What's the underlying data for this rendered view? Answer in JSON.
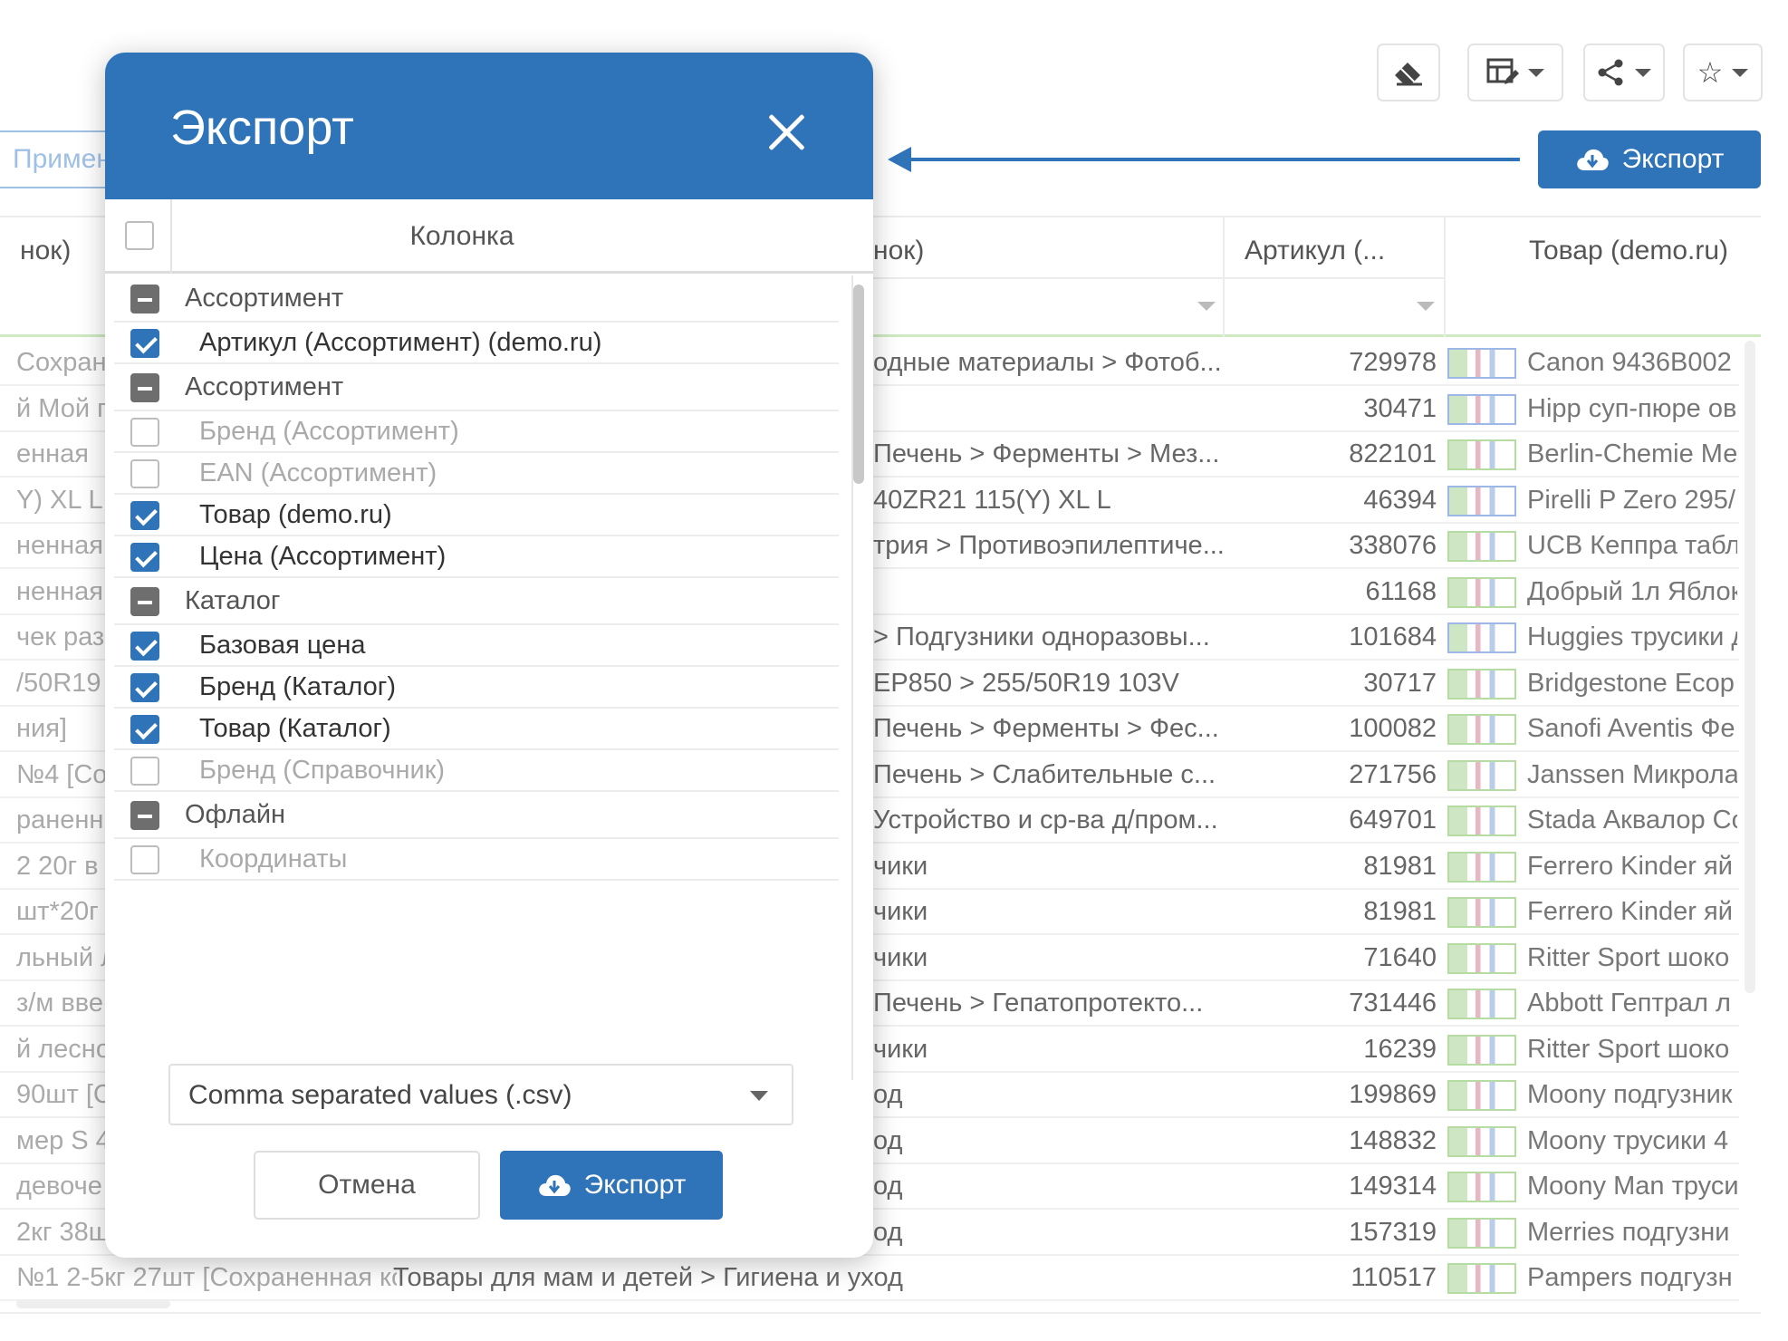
{
  "toolbar": {
    "clear_icon": "eraser-icon",
    "table_edit_icon": "table-edit-icon",
    "share_icon": "share-icon",
    "favorite_icon": "star-icon",
    "export_label": "Экспорт",
    "apply_label": "Применить"
  },
  "table": {
    "headers": {
      "category_partial": "нок)",
      "left_partial": "нок)",
      "article": "Артикул (...",
      "product": "Товар (demo.ru)"
    },
    "rows": [
      {
        "left": "Сохран",
        "category": "одные материалы > Фотоб...",
        "article": "729978",
        "name": "Canon 9436B002"
      },
      {
        "left": "й Мой г",
        "category": "",
        "article": "30471",
        "name": "Hipp суп-пюре ов"
      },
      {
        "left": "енная",
        "category": "Печень > Ферменты > Мез...",
        "article": "822101",
        "name": "Berlin-Chemie Ме"
      },
      {
        "left": "Y) XL L [",
        "category": "40ZR21 115(Y) XL L",
        "article": "46394",
        "name": "Pirelli P Zero 295/"
      },
      {
        "left": "ненная",
        "category": "трия > Противоэпилептиче...",
        "article": "338076",
        "name": "UCB Кеппра табл"
      },
      {
        "left": "ненная",
        "category": "",
        "article": "61168",
        "name": "Добрый 1л Яблок"
      },
      {
        "left": "чек раз",
        "category": "> Подгузники одноразовы...",
        "article": "101684",
        "name": "Huggies трусики д"
      },
      {
        "left": "/50R19",
        "category": "EP850 > 255/50R19 103V",
        "article": "30717",
        "name": "Bridgestone Ecop"
      },
      {
        "left": "ния]",
        "category": "Печень > Ферменты > Фес...",
        "article": "100082",
        "name": "Sanofi Aventis Фе"
      },
      {
        "left": "№4 [Со",
        "category": "Печень > Слабительные с...",
        "article": "271756",
        "name": "Janssen Микрола"
      },
      {
        "left": "раненн",
        "category": "Устройство и ср-ва д/пром...",
        "article": "649701",
        "name": "Stada Аквалор Со"
      },
      {
        "left": "2 20г в",
        "category": "чики",
        "article": "81981",
        "name": "Ferrero Kinder яй"
      },
      {
        "left": "шт*20г [",
        "category": "чики",
        "article": "81981",
        "name": "Ferrero Kinder яй"
      },
      {
        "left": "льный л",
        "category": "чики",
        "article": "71640",
        "name": "Ritter Sport шоко"
      },
      {
        "left": "з/м вве",
        "category": "Печень > Гепатопротекто...",
        "article": "731446",
        "name": "Abbott Гептрал л"
      },
      {
        "left": "й лесно",
        "category": "чики",
        "article": "16239",
        "name": "Ritter Sport шоко"
      },
      {
        "left": "90шт [С",
        "category": "од",
        "article": "199869",
        "name": "Moony подгузник"
      },
      {
        "left": "мер S 4",
        "category": "од",
        "article": "148832",
        "name": "Moony трусики 4"
      },
      {
        "left": "девоче",
        "category": "од",
        "article": "149314",
        "name": "Moony Man труси"
      },
      {
        "left": "2кг 38ш",
        "category": "од",
        "article": "157319",
        "name": "Merries подгузни"
      },
      {
        "left": "№1 2-5кг 27шт [Сохраненная ко",
        "category": "Товары для мам и детей > Гигиена и уход",
        "article": "110517",
        "name": "Pampers подгузн"
      }
    ]
  },
  "dialog": {
    "title": "Экспорт",
    "column_header": "Колонка",
    "items": [
      {
        "type": "group",
        "label": "Ассортимент"
      },
      {
        "type": "column",
        "label": "Артикул (Ассортимент) (demo.ru)",
        "checked": true
      },
      {
        "type": "group",
        "label": "Ассортимент"
      },
      {
        "type": "column",
        "label": "Бренд (Ассортимент)",
        "checked": false
      },
      {
        "type": "column",
        "label": "EAN (Ассортимент)",
        "checked": false
      },
      {
        "type": "column",
        "label": "Товар (demo.ru)",
        "checked": true
      },
      {
        "type": "column",
        "label": "Цена (Ассортимент)",
        "checked": true
      },
      {
        "type": "group",
        "label": "Каталог"
      },
      {
        "type": "column",
        "label": "Базовая цена",
        "checked": true
      },
      {
        "type": "column",
        "label": "Бренд (Каталог)",
        "checked": true
      },
      {
        "type": "column",
        "label": "Товар (Каталог)",
        "checked": true
      },
      {
        "type": "column",
        "label": "Бренд (Справочник)",
        "checked": false
      },
      {
        "type": "group",
        "label": "Офлайн"
      },
      {
        "type": "column",
        "label": "Координаты",
        "checked": false
      }
    ],
    "format_value": "Comma separated values (.csv)",
    "cancel_label": "Отмена",
    "export_label": "Экспорт"
  },
  "colors": {
    "accent": "#2f73b8",
    "checked": "#2f73b8",
    "group_indicator": "#6e6e6e"
  }
}
